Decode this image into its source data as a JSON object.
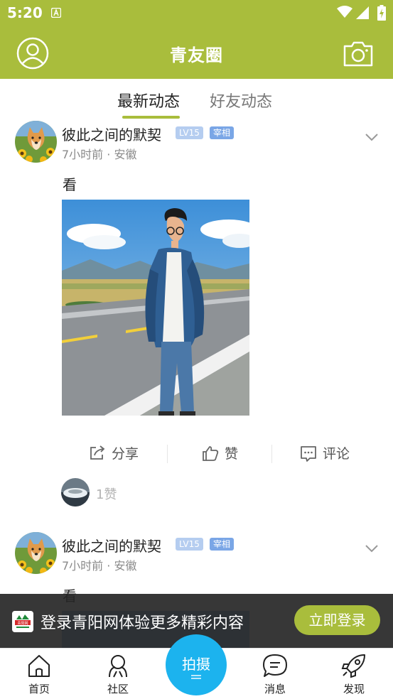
{
  "status_bar": {
    "time": "5:20"
  },
  "header": {
    "title": "青友圈"
  },
  "tabs": [
    {
      "label": "最新动态",
      "active": true
    },
    {
      "label": "好友动态",
      "active": false
    }
  ],
  "posts": [
    {
      "username": "彼此之间的默契",
      "level": "LV15",
      "badge": "宰相",
      "time": "7小时前",
      "location": "安徽",
      "separator": "·",
      "text": "看",
      "actions": {
        "share": "分享",
        "like": "赞",
        "comment": "评论"
      },
      "likes": "1赞"
    },
    {
      "username": "彼此之间的默契",
      "level": "LV15",
      "badge": "宰相",
      "time": "7小时前",
      "location": "安徽",
      "separator": "·",
      "text": "看"
    }
  ],
  "login_banner": {
    "message": "登录青阳网体验更多精彩内容",
    "button": "立即登录",
    "logo_text": "青阳网"
  },
  "bottom_nav": [
    {
      "label": "首页",
      "icon": "home-icon"
    },
    {
      "label": "社区",
      "icon": "community-icon"
    },
    {
      "label": "拍摄",
      "icon": "shoot-icon"
    },
    {
      "label": "消息",
      "icon": "message-icon"
    },
    {
      "label": "发现",
      "icon": "rocket-icon"
    }
  ],
  "colors": {
    "brand": "#a9bd3c",
    "shoot_button": "#1cb3ee",
    "level_badge": "#b5cdf0",
    "title_badge": "#7aa6e6"
  }
}
